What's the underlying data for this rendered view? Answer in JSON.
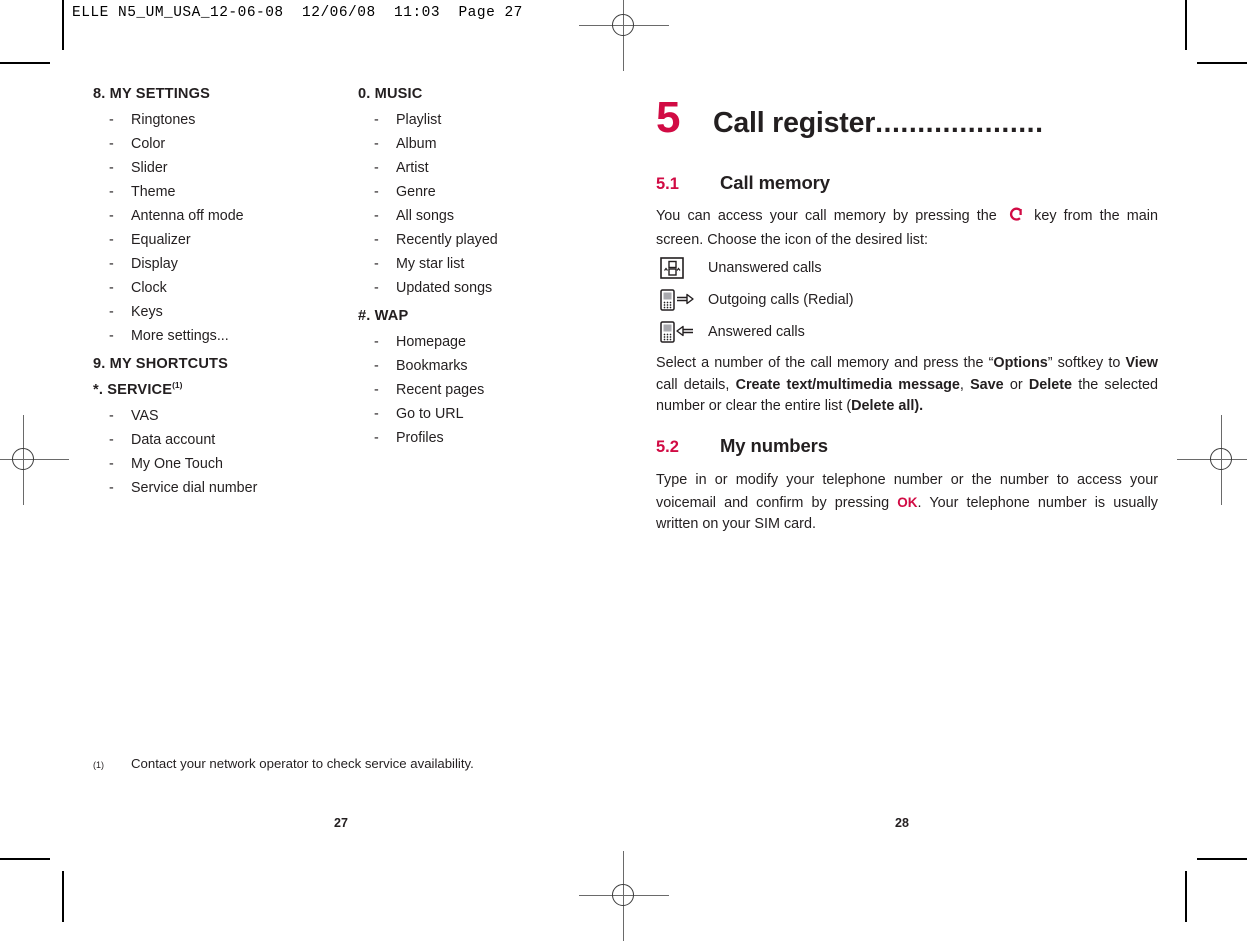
{
  "print_slug": "ELLE N5_UM_USA_12-06-08  12/06/08  11:03  Page 27",
  "colors": {
    "accent_red": "#d10b44",
    "text": "#231f20",
    "phone_icon_grey": "#8d8d8d"
  },
  "left_page": {
    "folio": "27",
    "columns": [
      {
        "sections": [
          {
            "heading": "8. MY SETTINGS",
            "footnote_marker": "",
            "items": [
              "Ringtones",
              "Color",
              "Slider",
              "Theme",
              "Antenna off mode",
              "Equalizer",
              "Display",
              "Clock",
              "Keys",
              "More settings..."
            ]
          },
          {
            "heading": "9. MY SHORTCUTS",
            "footnote_marker": "",
            "items": []
          },
          {
            "heading": "*. SERVICE",
            "footnote_marker": "(1)",
            "items": [
              "VAS",
              "Data account",
              "My One Touch",
              "Service dial number"
            ]
          }
        ]
      },
      {
        "sections": [
          {
            "heading": "0. MUSIC",
            "footnote_marker": "",
            "items": [
              "Playlist",
              "Album",
              "Artist",
              "Genre",
              "All songs",
              "Recently played",
              "My star list",
              "Updated songs"
            ]
          },
          {
            "heading": "#. WAP",
            "footnote_marker": "",
            "items": [
              "Homepage",
              "Bookmarks",
              "Recent pages",
              "Go to URL",
              "Profiles"
            ]
          }
        ]
      }
    ],
    "list_dash": "-",
    "footnote": {
      "marker": "(1)",
      "text": "Contact your network operator to check service availability."
    }
  },
  "right_page": {
    "folio": "28",
    "chapter": {
      "number": "5",
      "title": "Call register",
      "dots": "....................",
      "icon_name": "mobile-phone-icon"
    },
    "section_51": {
      "number": "5.1",
      "title": "Call memory",
      "intro_before_key": "You can access your call memory by pressing the",
      "key_glyph": "call-key-icon",
      "intro_after_key": "key from the main screen. Choose the icon of the desired list:",
      "icon_list": [
        {
          "icon": "unanswered-calls-icon",
          "label": "Unanswered calls"
        },
        {
          "icon": "outgoing-calls-icon",
          "label": "Outgoing calls (Redial)"
        },
        {
          "icon": "answered-calls-icon",
          "label": "Answered calls"
        }
      ],
      "options_paragraph": {
        "p1": "Select a number of the call memory and press the “",
        "b1": "Options",
        "p2": "” softkey to ",
        "b2": "View",
        "p3": " call details, ",
        "b3": "Create text/multimedia message",
        "p4": ", ",
        "b4": "Save",
        "p5": " or ",
        "b5": "Delete",
        "p6": " the selected number or clear the entire list (",
        "b6": "Delete all).",
        "p7": ""
      }
    },
    "section_52": {
      "number": "5.2",
      "title": "My numbers",
      "p1": "Type in or modify your telephone number or the number to access your voicemail and confirm by pressing",
      "ok_key": "OK",
      "p2": ". Your telephone number is usually written on your SIM card."
    }
  }
}
